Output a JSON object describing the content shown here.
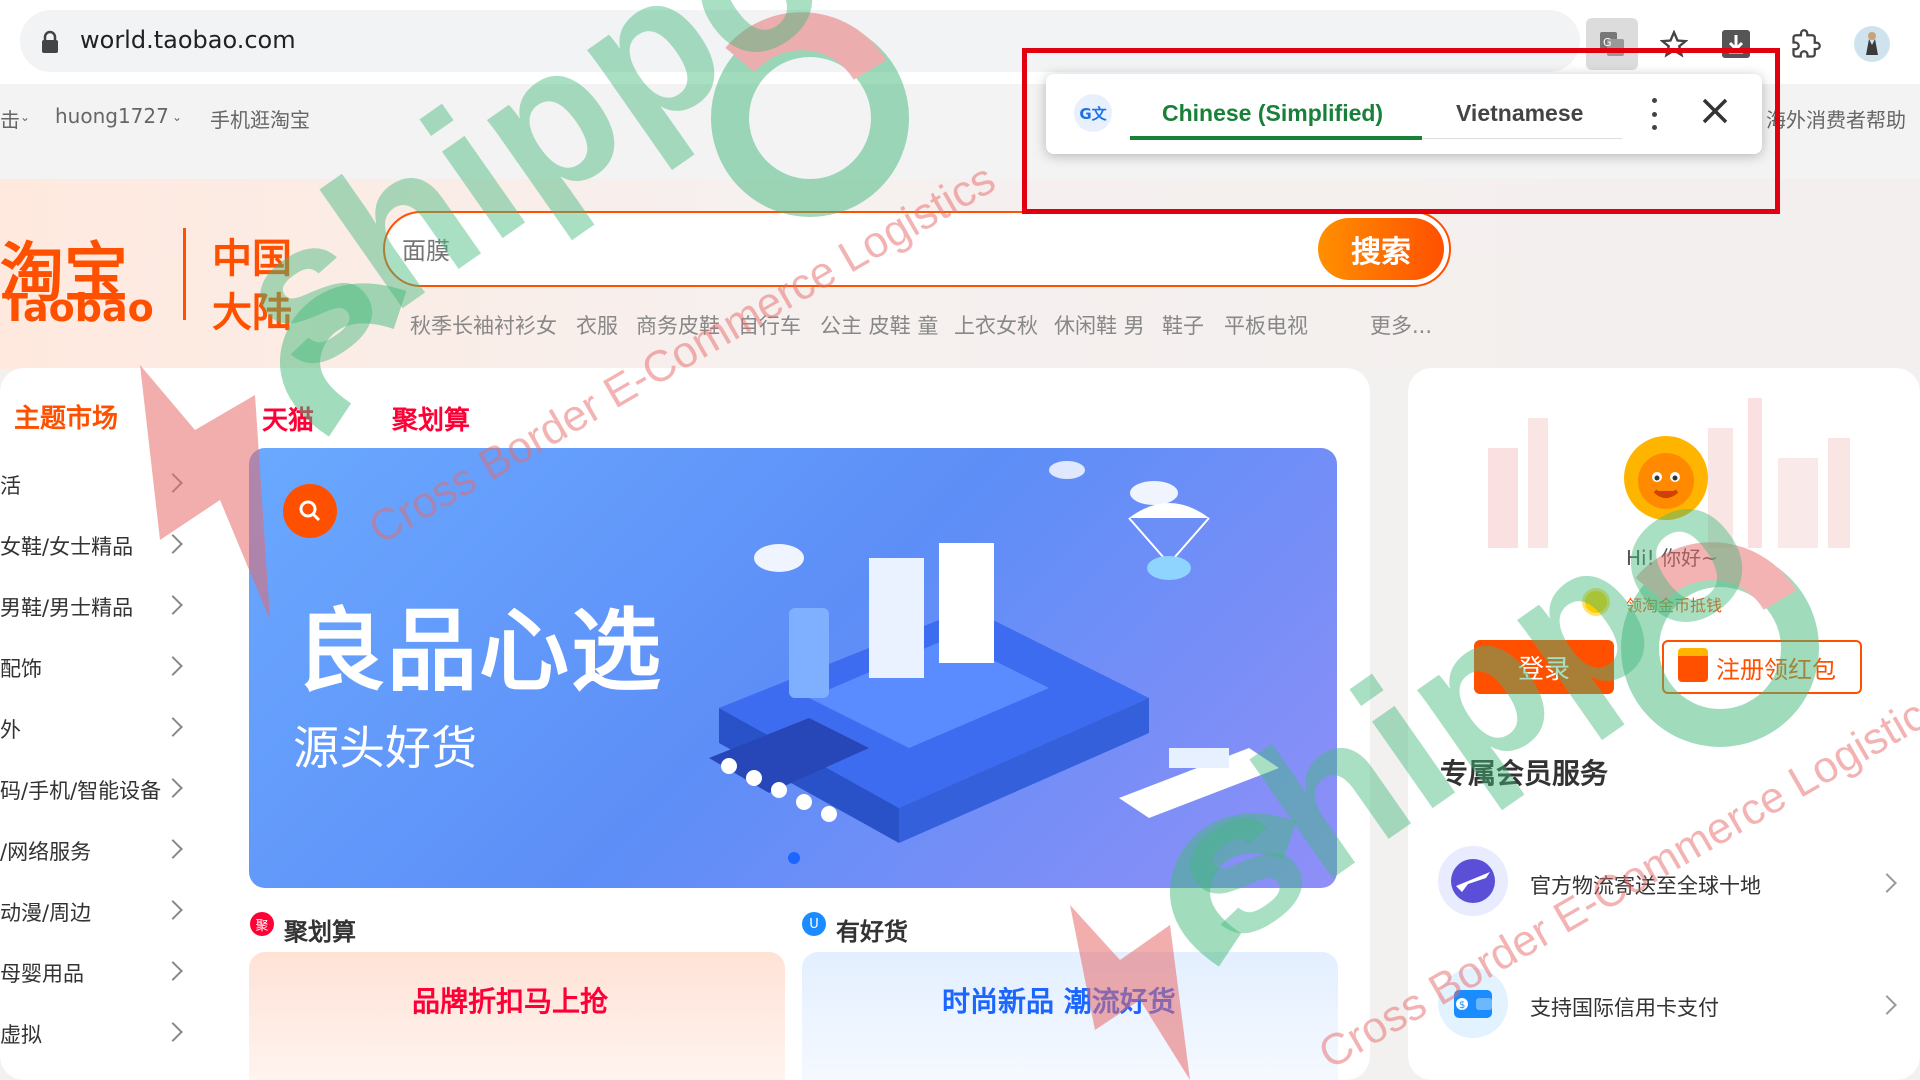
{
  "browser": {
    "url": "world.taobao.com",
    "icons": [
      "translate-icon",
      "star-icon",
      "download-icon",
      "extensions-icon",
      "profile-icon"
    ]
  },
  "translate_popup": {
    "source_language": "Chinese (Simplified)",
    "target_language": "Vietnamese",
    "icons": [
      "google-translate-icon",
      "more-vert-icon",
      "close-icon"
    ]
  },
  "site_bar": {
    "left_fragment": "击",
    "username": "huong1727",
    "mobile": "手机逛淘宝",
    "help": "海外消费者帮助"
  },
  "logo": {
    "chinese": "淘宝",
    "english": "Taobao",
    "region_line1": "中国",
    "region_line2": "大陆"
  },
  "search": {
    "placeholder": "面膜",
    "button": "搜索",
    "hot_terms": [
      "秋季长袖衬衫女",
      "衣服",
      "商务皮鞋",
      "自行车",
      "公主 皮鞋 童",
      "上衣女秋",
      "休闲鞋 男",
      "鞋子",
      "平板电视"
    ],
    "more": "更多..."
  },
  "categories": {
    "title": "主题市场",
    "items": [
      "活",
      "女鞋/女士精品",
      "男鞋/男士精品",
      "配饰",
      "外",
      "码/手机/智能设备",
      "/网络服务",
      "动漫/周边",
      "母婴用品",
      "虚拟"
    ]
  },
  "tabs": [
    "天猫",
    "聚划算"
  ],
  "banner": {
    "title": "良品心选",
    "subtitle": "源头好货"
  },
  "sections": {
    "juhuasuan": {
      "badge": "聚",
      "title": "聚划算",
      "card_title": "品牌折扣马上抢"
    },
    "youhaohuo": {
      "badge": "U",
      "title": "有好货",
      "card_title": "时尚新品 潮流好货"
    }
  },
  "user_panel": {
    "greeting": "Hi! 你好~",
    "coin_text": "领淘金币抵钱",
    "login": "登录",
    "register": "注册领红包",
    "member_title": "专属会员服务",
    "services": [
      {
        "text": "官方物流寄送至全球十地",
        "icon": "airplane-icon"
      },
      {
        "text": "支持国际信用卡支付",
        "icon": "wallet-icon"
      }
    ]
  },
  "watermark": {
    "brand": "shippo",
    "tagline": "Cross Border E-Commerce Logistics"
  },
  "colors": {
    "taobao_orange": "#ff5000",
    "tmall_red": "#ff0036",
    "translate_green": "#188038",
    "highlight_box": "#e20010"
  }
}
